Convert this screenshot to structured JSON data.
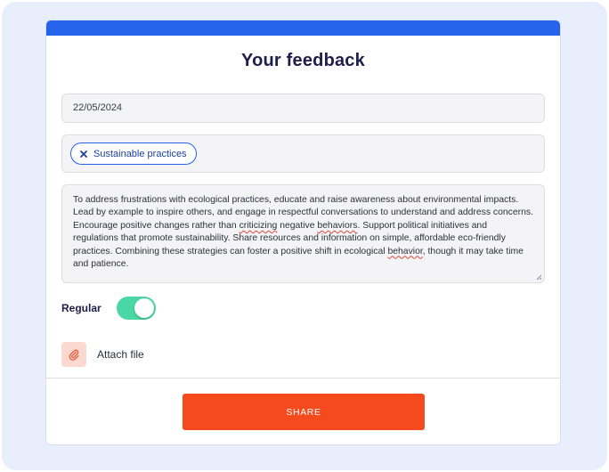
{
  "form": {
    "title": "Your feedback",
    "date_value": "22/05/2024",
    "tags": [
      {
        "label": "Sustainable practices",
        "icon": "close-icon"
      }
    ],
    "textarea": {
      "p1": "To address frustrations with ecological practices, educate and raise awareness about environmental impacts. Lead by example to inspire others, and engage in respectful conversations to understand and address concerns. Encourage positive changes rather than ",
      "w1": "criticizing",
      "p2": " negative ",
      "w2": "behaviors",
      "p3": ". Support political initiatives and regulations that promote sustainability. Share resources and information on simple, affordable eco-friendly practices. Combining these strategies can foster a positive shift in ecological ",
      "w3": "behavior",
      "p4": ", though it may take time and patience."
    },
    "toggle": {
      "label": "Regular",
      "checked": true
    },
    "attach": {
      "label": "Attach file",
      "icon": "paperclip-icon"
    },
    "share_label": "SHARE"
  },
  "colors": {
    "accent": "#2563eb",
    "toggle_on": "#48d7a5",
    "share_button": "#f44a1d",
    "attach_bg": "#fbd9d1",
    "backdrop": "#e8eefc"
  }
}
